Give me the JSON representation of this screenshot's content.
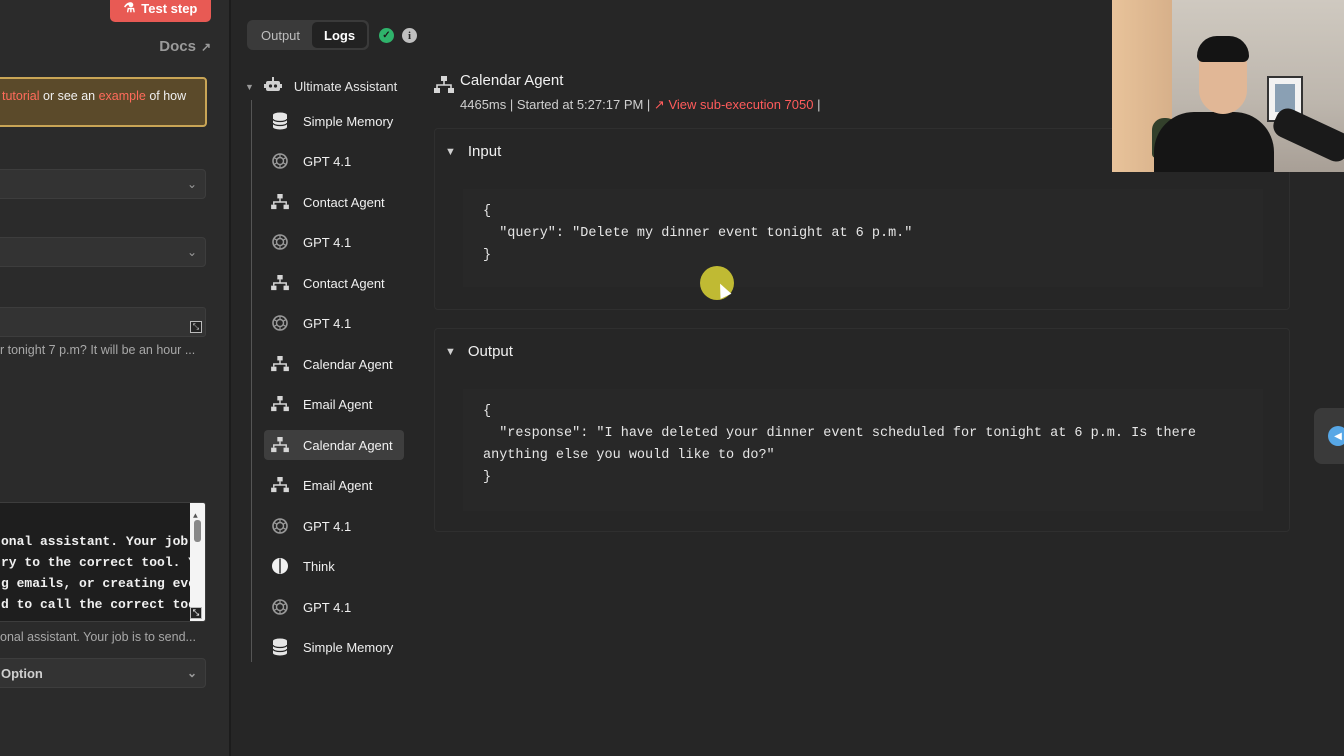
{
  "left_panel": {
    "test_step_label": "Test step",
    "docs_label": "Docs",
    "tip": {
      "link1": "tutorial",
      "middle": " or see an ",
      "link2": "example",
      "end": " of how"
    },
    "hint1": "r tonight 7 p.m? It will be an hour ...",
    "system_message_lines": [
      "onal assistant. Your job",
      "ry to the correct tool. Y",
      "g emails, or creating eve",
      "d to call the correct too"
    ],
    "hint2": "onal assistant. Your job is to send...",
    "option_label": "Option"
  },
  "center": {
    "tabs": [
      {
        "label": "Output",
        "active": false
      },
      {
        "label": "Logs",
        "active": true
      }
    ],
    "tree": {
      "root": "Ultimate Assistant",
      "items": [
        {
          "label": "Simple Memory",
          "icon": "database-icon"
        },
        {
          "label": "GPT 4.1",
          "icon": "openai-icon"
        },
        {
          "label": "Contact Agent",
          "icon": "workflow-icon"
        },
        {
          "label": "GPT 4.1",
          "icon": "openai-icon"
        },
        {
          "label": "Contact Agent",
          "icon": "workflow-icon"
        },
        {
          "label": "GPT 4.1",
          "icon": "openai-icon"
        },
        {
          "label": "Calendar Agent",
          "icon": "workflow-icon"
        },
        {
          "label": "Email Agent",
          "icon": "workflow-icon"
        },
        {
          "label": "Calendar Agent",
          "icon": "workflow-icon",
          "active": true
        },
        {
          "label": "Email Agent",
          "icon": "workflow-icon"
        },
        {
          "label": "GPT 4.1",
          "icon": "openai-icon"
        },
        {
          "label": "Think",
          "icon": "brain-icon"
        },
        {
          "label": "GPT 4.1",
          "icon": "openai-icon"
        },
        {
          "label": "Simple Memory",
          "icon": "database-icon"
        }
      ]
    },
    "agent": {
      "title": "Calendar Agent",
      "meta_prefix": "4465ms | Started at 5:27:17 PM | ",
      "sub_execution": "View sub-execution 7050"
    },
    "input": {
      "heading": "Input",
      "json": "{\n  \"query\": \"Delete my dinner event tonight at 6 p.m.\"\n}"
    },
    "output": {
      "heading": "Output",
      "json": "{\n  \"response\": \"I have deleted your dinner event scheduled for tonight at 6 p.m. Is there\nanything else you would like to do?\"\n}"
    }
  },
  "colors": {
    "accent_red": "#e85a54",
    "link_red": "#ff5b5b",
    "success_green": "#2fb36b",
    "cursor_highlight": "#c8c234"
  }
}
